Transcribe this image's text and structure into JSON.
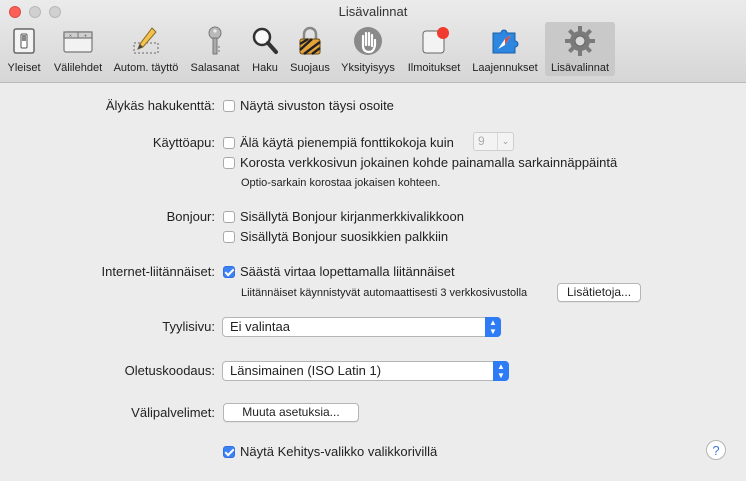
{
  "window": {
    "title": "Lisävalinnat"
  },
  "toolbar": {
    "tabs": [
      {
        "label": "Yleiset",
        "icon": "general-switch-icon"
      },
      {
        "label": "Välilehdet",
        "icon": "tabs-icon"
      },
      {
        "label": "Autom. täyttö",
        "icon": "autofill-pencil-icon"
      },
      {
        "label": "Salasanat",
        "icon": "key-icon"
      },
      {
        "label": "Haku",
        "icon": "magnifier-icon"
      },
      {
        "label": "Suojaus",
        "icon": "lock-icon"
      },
      {
        "label": "Yksityisyys",
        "icon": "hand-icon"
      },
      {
        "label": "Ilmoitukset",
        "icon": "notification-icon"
      },
      {
        "label": "Laajennukset",
        "icon": "extensions-compass-icon"
      },
      {
        "label": "Lisävalinnat",
        "icon": "gear-icon",
        "active": true
      }
    ]
  },
  "smart_search": {
    "label": "Älykäs hakukenttä:",
    "show_full_address": {
      "label": "Näytä sivuston täysi osoite",
      "checked": false
    }
  },
  "accessibility": {
    "label": "Käyttöapu:",
    "min_font": {
      "label": "Älä käytä pienempiä fonttikokoja kuin",
      "checked": false,
      "value": "9"
    },
    "tab_highlight": {
      "label": "Korosta verkkosivun jokainen kohde painamalla sarkainnäppäintä",
      "checked": false
    },
    "hint": "Optio-sarkain korostaa jokaisen kohteen."
  },
  "bonjour": {
    "label": "Bonjour:",
    "bookmarks_menu": {
      "label": "Sisällytä Bonjour kirjanmerkkivalikkoon",
      "checked": false
    },
    "favorites_bar": {
      "label": "Sisällytä Bonjour suosikkien palkkiin",
      "checked": false
    }
  },
  "plugins": {
    "label": "Internet-liitännäiset:",
    "save_power": {
      "label": "Säästä virtaa lopettamalla liitännäiset",
      "checked": true
    },
    "info": "Liitännäiset käynnistyvät automaattisesti 3 verkkosivustolla",
    "more_button": "Lisätietoja..."
  },
  "stylesheet": {
    "label": "Tyylisivu:",
    "value": "Ei valintaa"
  },
  "encoding": {
    "label": "Oletuskoodaus:",
    "value": "Länsimainen (ISO Latin 1)"
  },
  "proxies": {
    "label": "Välipalvelimet:",
    "button": "Muuta asetuksia..."
  },
  "develop_menu": {
    "label": "Näytä Kehitys-valikko valikkorivillä",
    "checked": true
  },
  "help": {
    "label": "?"
  },
  "colors": {
    "accent": "#2d7cf6",
    "close": "#fc5f57"
  }
}
